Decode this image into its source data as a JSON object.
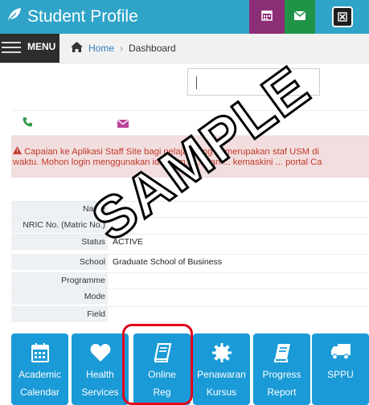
{
  "header": {
    "title": "Student Profile"
  },
  "breadcrumb": {
    "menu_label": "MENU",
    "home": "Home",
    "current": "Dashboard"
  },
  "alert": {
    "line1": "Capaian ke Aplikasi Staff Site bagi pelajar yang ... merupakan staf USM di",
    "line2": "waktu. Mohon login menggunakan id@usm.m... dan ... kemaskini ... portal Ca"
  },
  "profile": {
    "labels": {
      "name": "Name",
      "nric": "NRIC No. (Matric No.)",
      "status": "Status",
      "school": "School",
      "programme": "Programme",
      "mode": "Mode",
      "field": "Field"
    },
    "values": {
      "status": "ACTIVE",
      "school": "Graduate School of Business"
    }
  },
  "tiles": [
    {
      "line1": "Academic",
      "line2": "Calendar",
      "icon": "calendar-icon"
    },
    {
      "line1": "Health",
      "line2": "Services",
      "icon": "heart-icon"
    },
    {
      "line1": "Online",
      "line2": "Reg",
      "icon": "book-icon"
    },
    {
      "line1": "Penawaran",
      "line2": "Kursus",
      "icon": "gear-icon"
    },
    {
      "line1": "Progress",
      "line2": "Report",
      "icon": "book-icon"
    },
    {
      "line1": "SPPU",
      "line2": "",
      "icon": "truck-icon"
    }
  ],
  "watermark": {
    "text": "SAMPLE"
  },
  "colors": {
    "topbar": "#2fa4c8",
    "calendar_btn": "#8c2e76",
    "mail_btn": "#1f9448",
    "tile": "#1a9ad6",
    "highlight": "#e3001b",
    "alert_bg": "#f2dede",
    "alert_text": "#c0392b"
  }
}
